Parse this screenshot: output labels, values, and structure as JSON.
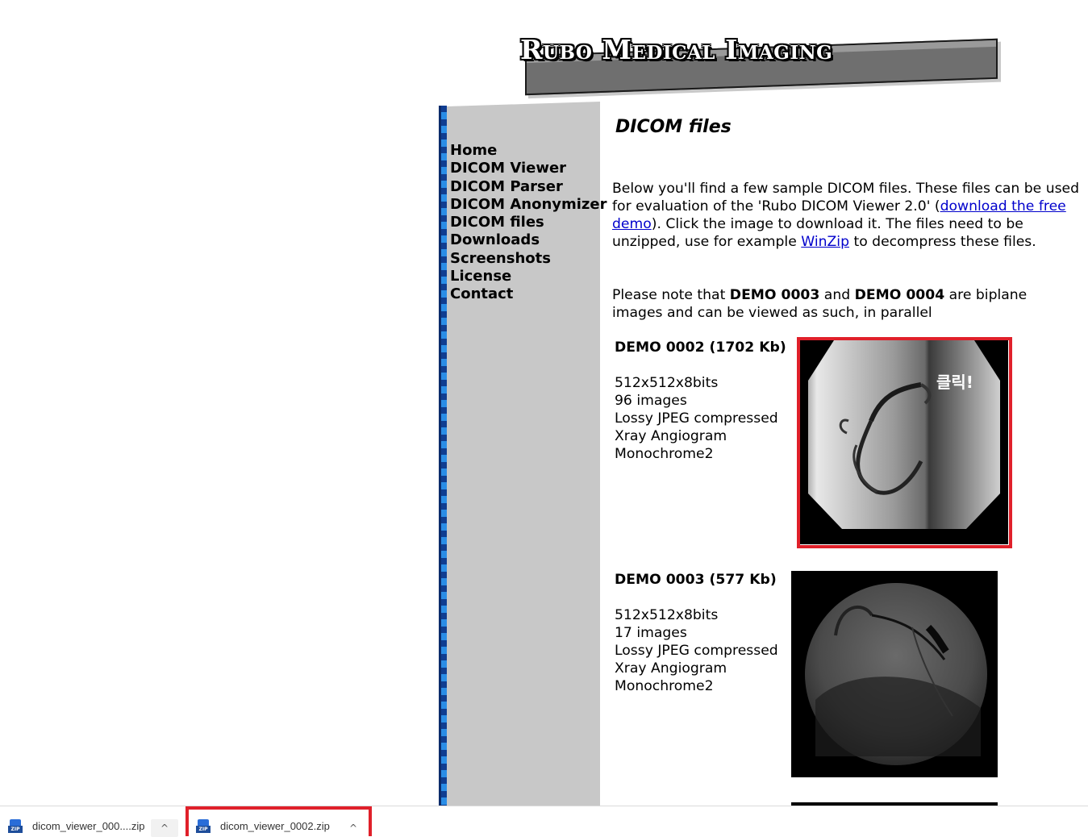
{
  "logo": {
    "text": "Rubo Medical Imaging"
  },
  "nav": [
    {
      "label": "Home"
    },
    {
      "label": "DICOM Viewer"
    },
    {
      "label": "DICOM Parser"
    },
    {
      "label": "DICOM Anonymizer"
    },
    {
      "label": "DICOM files"
    },
    {
      "label": "Downloads"
    },
    {
      "label": "Screenshots"
    },
    {
      "label": "License"
    },
    {
      "label": "Contact"
    }
  ],
  "main": {
    "title": "DICOM files",
    "intro": {
      "text1": "Below you'll find a few sample DICOM files. These files can be used for evaluation of the 'Rubo DICOM Viewer 2.0' (",
      "link1": "download the free demo",
      "text2": "). Click the image to download it. The files need to be unzipped, use for example ",
      "link2": "WinZip",
      "text3": " to decompress these files."
    },
    "note": {
      "text1": "Please note that ",
      "bold1": "DEMO 0003",
      "text2": " and ",
      "bold2": "DEMO 0004",
      "text3": " are biplane images and can be viewed as such, in parallel"
    },
    "demos": [
      {
        "heading": "DEMO 0002 (1702 Kb)",
        "specs": [
          "512x512x8bits",
          "96 images",
          "Lossy JPEG compressed",
          "Xray Angiogram",
          "Monochrome2"
        ]
      },
      {
        "heading": "DEMO 0003 (577 Kb)",
        "specs": [
          "512x512x8bits",
          "17 images",
          "Lossy JPEG compressed",
          "Xray Angiogram",
          "Monochrome2"
        ]
      }
    ],
    "click_label": "클릭!"
  },
  "downloads": [
    {
      "name": "dicom_viewer_000....zip",
      "icon": "zip-file-icon"
    },
    {
      "name": "dicom_viewer_0002.zip",
      "icon": "zip-file-icon"
    }
  ],
  "icons": {
    "chevron": "^",
    "zip_badge": "ZIP"
  },
  "colors": {
    "highlight": "#e0202a",
    "link": "#0000cc",
    "sidebar": "#c8c8c8",
    "strip_dark": "#0f3d91",
    "strip_light": "#2a8de6"
  }
}
